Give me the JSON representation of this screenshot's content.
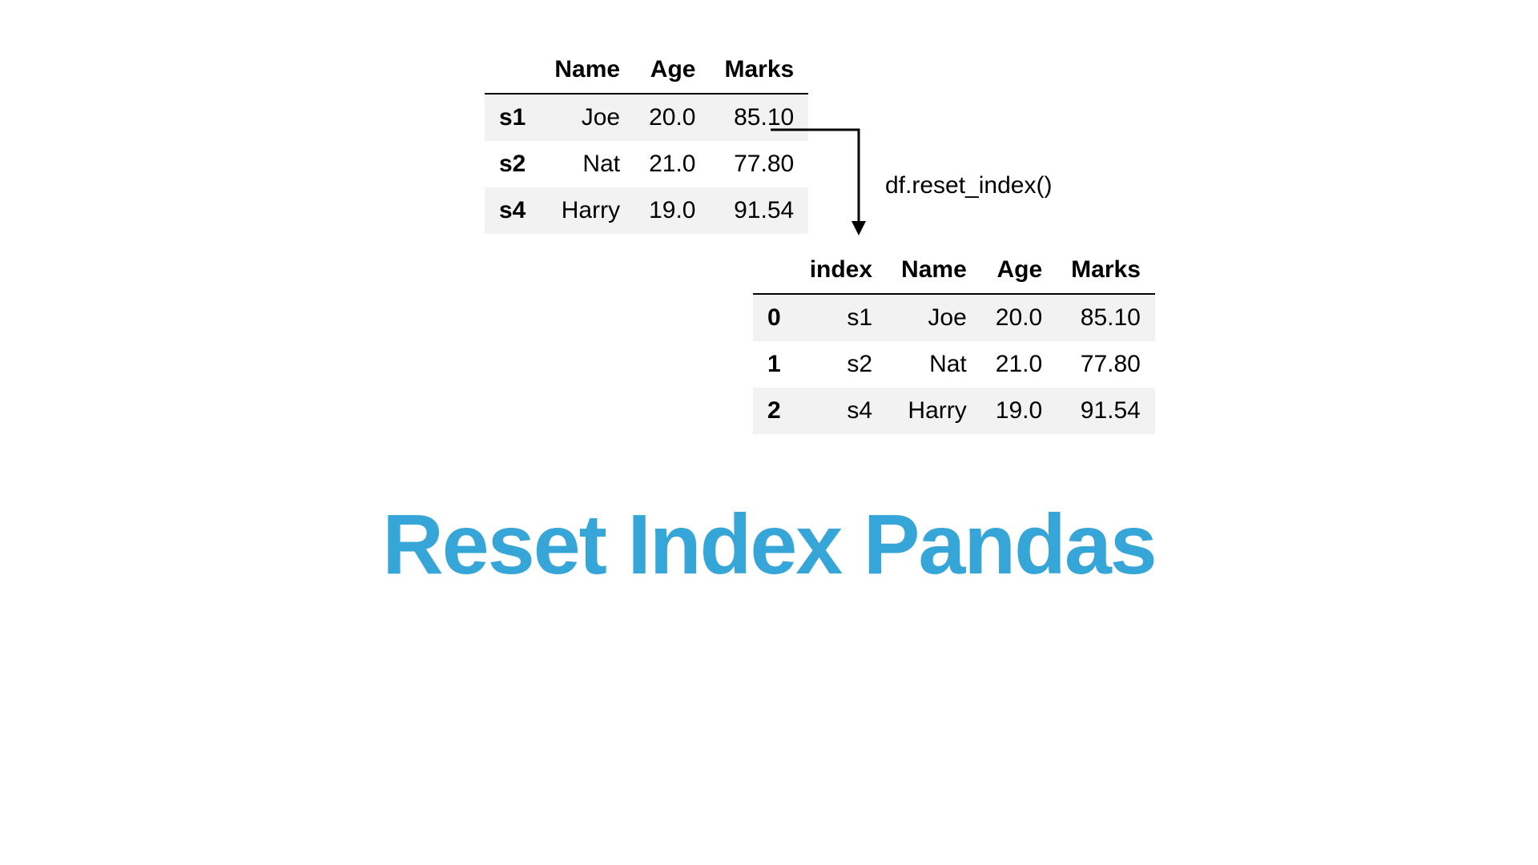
{
  "table_before": {
    "columns": [
      "",
      "Name",
      "Age",
      "Marks"
    ],
    "rows": [
      {
        "idx": "s1",
        "name": "Joe",
        "age": "20.0",
        "marks": "85.10"
      },
      {
        "idx": "s2",
        "name": "Nat",
        "age": "21.0",
        "marks": "77.80"
      },
      {
        "idx": "s4",
        "name": "Harry",
        "age": "19.0",
        "marks": "91.54"
      }
    ]
  },
  "code_label": "df.reset_index()",
  "table_after": {
    "columns": [
      "",
      "index",
      "Name",
      "Age",
      "Marks"
    ],
    "rows": [
      {
        "idx": "0",
        "oldidx": "s1",
        "name": "Joe",
        "age": "20.0",
        "marks": "85.10"
      },
      {
        "idx": "1",
        "oldidx": "s2",
        "name": "Nat",
        "age": "21.0",
        "marks": "77.80"
      },
      {
        "idx": "2",
        "oldidx": "s4",
        "name": "Harry",
        "age": "19.0",
        "marks": "91.54"
      }
    ]
  },
  "title": "Reset Index Pandas"
}
